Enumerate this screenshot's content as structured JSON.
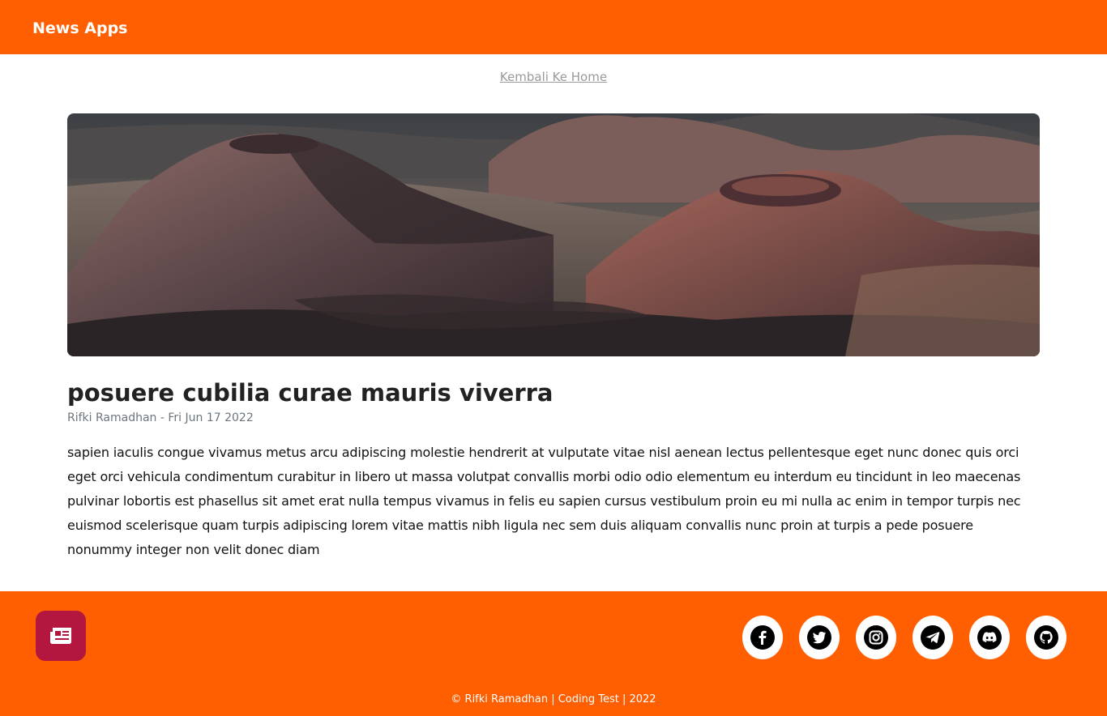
{
  "navbar": {
    "brand": "News Apps"
  },
  "nav": {
    "back_link": "Kembali Ke Home"
  },
  "hero": {
    "icon": "volcanic-landscape-image"
  },
  "article": {
    "title": "posuere cubilia curae mauris viverra",
    "author": "Rifki Ramadhan",
    "separator": " - ",
    "date": "Fri Jun 17 2022",
    "body": "sapien iaculis congue vivamus metus arcu adipiscing molestie hendrerit at vulputate vitae nisl aenean lectus pellentesque eget nunc donec quis orci eget orci vehicula condimentum curabitur in libero ut massa volutpat convallis morbi odio odio elementum eu interdum eu tincidunt in leo maecenas pulvinar lobortis est phasellus sit amet erat nulla tempus vivamus in felis eu sapien cursus vestibulum proin eu mi nulla ac enim in tempor turpis nec euismod scelerisque quam turpis adipiscing lorem vitae mattis nibh ligula nec sem duis aliquam convallis nunc proin at turpis a pede posuere nonummy integer non velit donec diam"
  },
  "footer": {
    "logo_icon": "newspaper-icon",
    "socials": [
      {
        "name": "facebook",
        "icon": "facebook-icon"
      },
      {
        "name": "twitter",
        "icon": "twitter-icon"
      },
      {
        "name": "instagram",
        "icon": "instagram-icon"
      },
      {
        "name": "telegram",
        "icon": "telegram-icon"
      },
      {
        "name": "discord",
        "icon": "discord-icon"
      },
      {
        "name": "github",
        "icon": "github-icon"
      }
    ],
    "copyright": "© Rifki Ramadhan | Coding Test | 2022"
  },
  "colors": {
    "brand_orange": "#ff5f00",
    "logo_crimson": "#b3173f",
    "link_gray": "#9a9a9a",
    "meta_gray": "#6c757d"
  }
}
